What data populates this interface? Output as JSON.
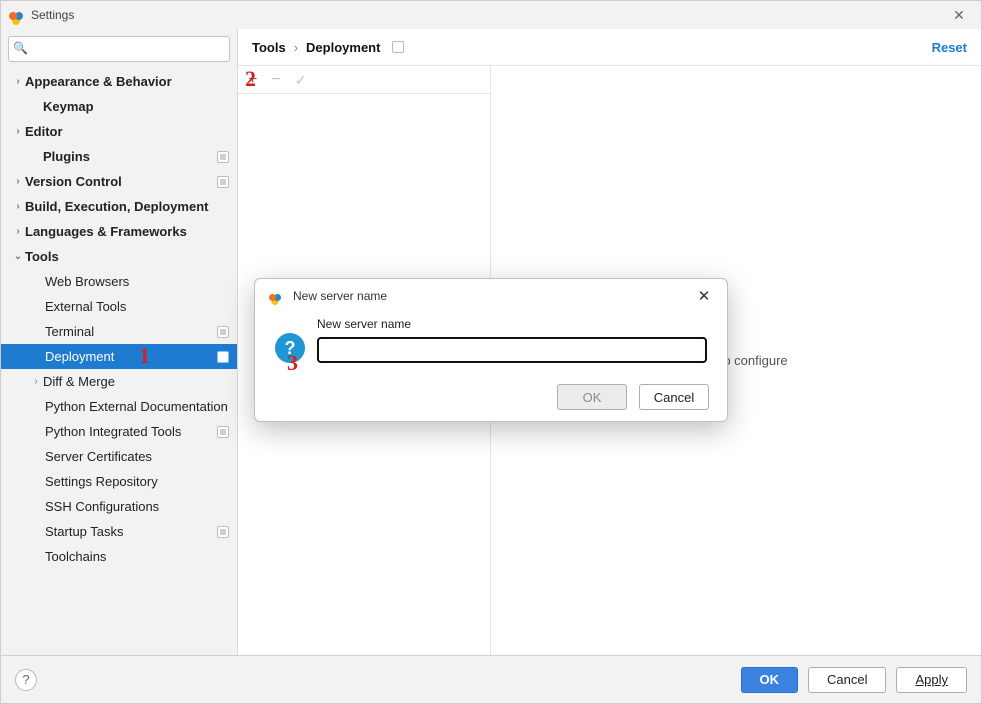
{
  "window": {
    "title": "Settings",
    "close_glyph": "✕"
  },
  "search": {
    "placeholder": ""
  },
  "sidebar": {
    "items": [
      {
        "label": "Appearance & Behavior",
        "level": 0,
        "chev": "›",
        "badge": false
      },
      {
        "label": "Keymap",
        "level": 0,
        "chev": "",
        "badge": false
      },
      {
        "label": "Editor",
        "level": 0,
        "chev": "›",
        "badge": false
      },
      {
        "label": "Plugins",
        "level": 0,
        "chev": "",
        "badge": true
      },
      {
        "label": "Version Control",
        "level": 0,
        "chev": "›",
        "badge": true
      },
      {
        "label": "Build, Execution, Deployment",
        "level": 0,
        "chev": "›",
        "badge": false
      },
      {
        "label": "Languages & Frameworks",
        "level": 0,
        "chev": "›",
        "badge": false
      },
      {
        "label": "Tools",
        "level": 0,
        "chev": "⌄",
        "badge": false
      },
      {
        "label": "Web Browsers",
        "level": 1,
        "chev": "",
        "badge": false
      },
      {
        "label": "External Tools",
        "level": 1,
        "chev": "",
        "badge": false
      },
      {
        "label": "Terminal",
        "level": 1,
        "chev": "",
        "badge": true
      },
      {
        "label": "Deployment",
        "level": 1,
        "chev": "",
        "badge": true,
        "selected": true
      },
      {
        "label": "Diff & Merge",
        "level": 1,
        "chev": "›",
        "badge": false,
        "haschev": true
      },
      {
        "label": "Python External Documentation",
        "level": 1,
        "chev": "",
        "badge": false
      },
      {
        "label": "Python Integrated Tools",
        "level": 1,
        "chev": "",
        "badge": true
      },
      {
        "label": "Server Certificates",
        "level": 1,
        "chev": "",
        "badge": false
      },
      {
        "label": "Settings Repository",
        "level": 1,
        "chev": "",
        "badge": false
      },
      {
        "label": "SSH Configurations",
        "level": 1,
        "chev": "",
        "badge": false
      },
      {
        "label": "Startup Tasks",
        "level": 1,
        "chev": "",
        "badge": true
      },
      {
        "label": "Toolchains",
        "level": 1,
        "chev": "",
        "badge": false
      }
    ]
  },
  "breadcrumb": {
    "part1": "Tools",
    "sep": "›",
    "part2": "Deployment"
  },
  "reset": "Reset",
  "toolbar": {
    "plus": "+",
    "minus": "−",
    "check": "✓"
  },
  "placeholder_text": "serve to configure",
  "footer": {
    "help": "?",
    "ok": "OK",
    "cancel": "Cancel",
    "apply": "Apply"
  },
  "dialog": {
    "title": "New server name",
    "label": "New server name",
    "value": "",
    "qmark": "?",
    "ok": "OK",
    "cancel": "Cancel",
    "close_glyph": "✕"
  },
  "annotations": {
    "a1": "1",
    "a2": "2",
    "a3": "3"
  }
}
